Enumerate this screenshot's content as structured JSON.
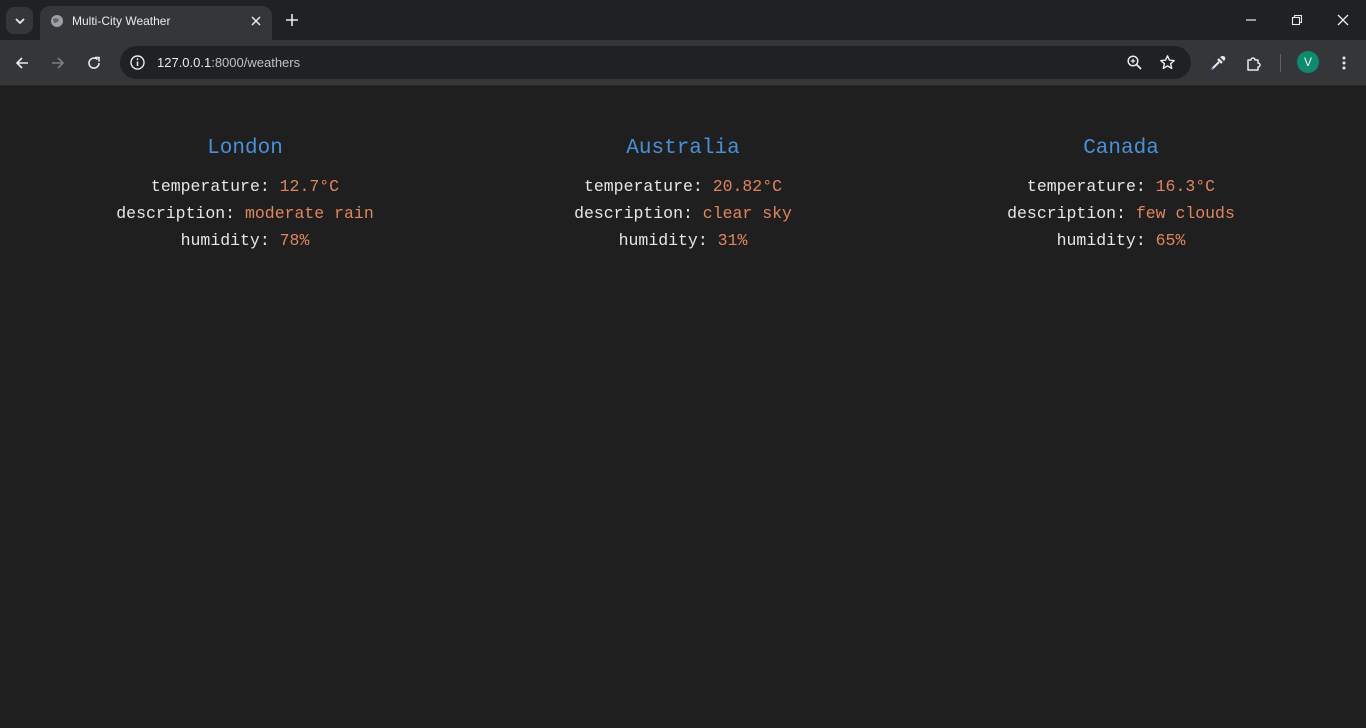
{
  "browser": {
    "tab_title": "Multi-City Weather",
    "url_host": "127.0.0.1",
    "url_rest": ":8000/weathers",
    "profile_initial": "V"
  },
  "weather": {
    "labels": {
      "temperature": "temperature: ",
      "description": "description: ",
      "humidity": "humidity: "
    },
    "cities": [
      {
        "name": "London",
        "temperature": "12.7°C",
        "description": "moderate rain",
        "humidity": "78%"
      },
      {
        "name": "Australia",
        "temperature": "20.82°C",
        "description": "clear sky",
        "humidity": "31%"
      },
      {
        "name": "Canada",
        "temperature": "16.3°C",
        "description": "few clouds",
        "humidity": "65%"
      }
    ]
  },
  "colors": {
    "page_background": "#1f1f1f",
    "city_name": "#4a90d9",
    "value": "#e0855f",
    "label": "#e6e6e6"
  }
}
